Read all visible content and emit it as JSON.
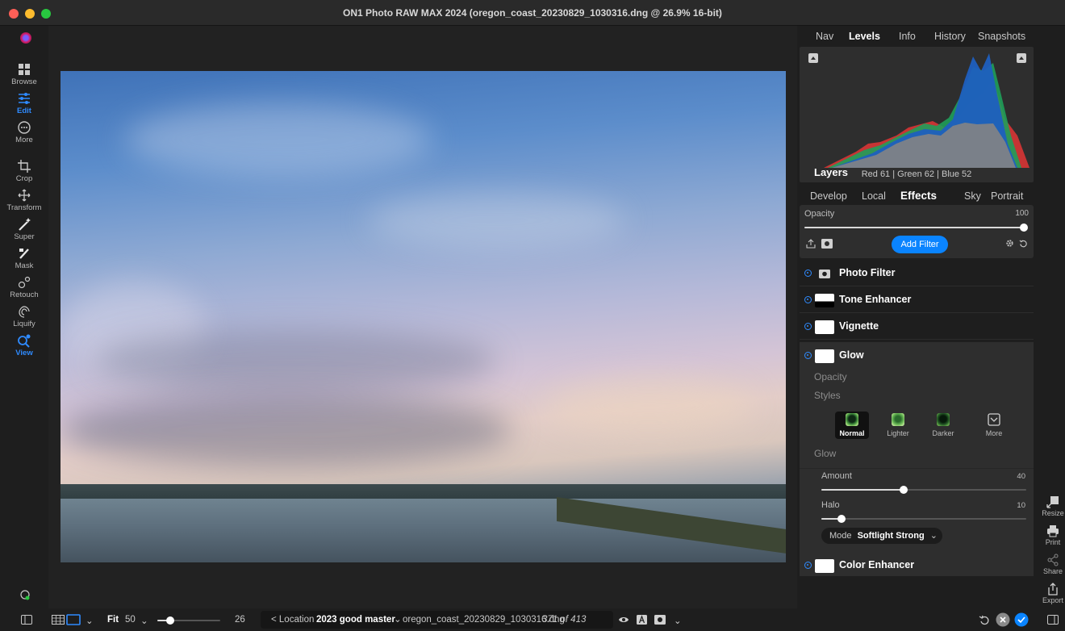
{
  "window": {
    "title": "ON1 Photo RAW MAX 2024 (oregon_coast_20230829_1030316.dng @ 26.9% 16-bit)"
  },
  "left_toolbar": [
    {
      "label": "Browse",
      "icon": "browse-icon"
    },
    {
      "label": "Edit",
      "icon": "edit-sliders-icon",
      "active": true
    },
    {
      "label": "More",
      "icon": "more-icon"
    },
    {
      "label": "Crop",
      "icon": "crop-icon"
    },
    {
      "label": "Transform",
      "icon": "transform-icon"
    },
    {
      "label": "Super",
      "icon": "magic-wand-icon"
    },
    {
      "label": "Mask",
      "icon": "mask-brush-icon"
    },
    {
      "label": "Retouch",
      "icon": "retouch-icon"
    },
    {
      "label": "Liquify",
      "icon": "liquify-icon"
    },
    {
      "label": "View",
      "icon": "view-zoom-icon",
      "active": true
    }
  ],
  "panel_tabs": [
    "Nav",
    "Levels",
    "Info",
    "History",
    "Snapshots"
  ],
  "active_panel_tab": "Levels",
  "histogram": {
    "readout": "Red 61 | Green 62 | Blue 52"
  },
  "layers": {
    "title": "Layers"
  },
  "filter_tabs": [
    "Develop",
    "Local",
    "Effects",
    "Sky",
    "Portrait"
  ],
  "active_filter_tab": "Effects",
  "opacity": {
    "label": "Opacity",
    "value": "100",
    "fraction": 1.0
  },
  "add_filter_label": "Add Filter",
  "filters": [
    {
      "name": "Photo Filter"
    },
    {
      "name": "Tone Enhancer"
    },
    {
      "name": "Vignette"
    },
    {
      "name": "Glow"
    },
    {
      "name": "Color Enhancer"
    }
  ],
  "glow": {
    "opacity_label": "Opacity",
    "styles_label": "Styles",
    "styles": [
      {
        "label": "Normal",
        "selected": true
      },
      {
        "label": "Lighter"
      },
      {
        "label": "Darker"
      },
      {
        "label": "More"
      }
    ],
    "section_label": "Glow",
    "amount": {
      "label": "Amount",
      "value": "40",
      "fraction": 0.4
    },
    "halo": {
      "label": "Halo",
      "value": "10",
      "fraction": 0.1
    },
    "mode_label": "Mode",
    "mode_value": "Softlight Strong"
  },
  "right_tools": [
    {
      "label": "Resize",
      "icon": "resize-icon"
    },
    {
      "label": "Print",
      "icon": "print-icon"
    },
    {
      "label": "Share",
      "icon": "share-icon"
    },
    {
      "label": "Export",
      "icon": "export-icon"
    }
  ],
  "bottom": {
    "fit_label": "Fit",
    "zoom_value": "50",
    "size_value": "26",
    "location_label": "< Location",
    "location_value": "2023 good master",
    "filename": "oregon_coast_20230829_1030316.dng",
    "count": "371 of 413",
    "size_fraction": 0.2
  },
  "colors": {
    "accent": "#0a84ff",
    "panel": "#2e2e2e",
    "background": "#1e1e1e"
  }
}
